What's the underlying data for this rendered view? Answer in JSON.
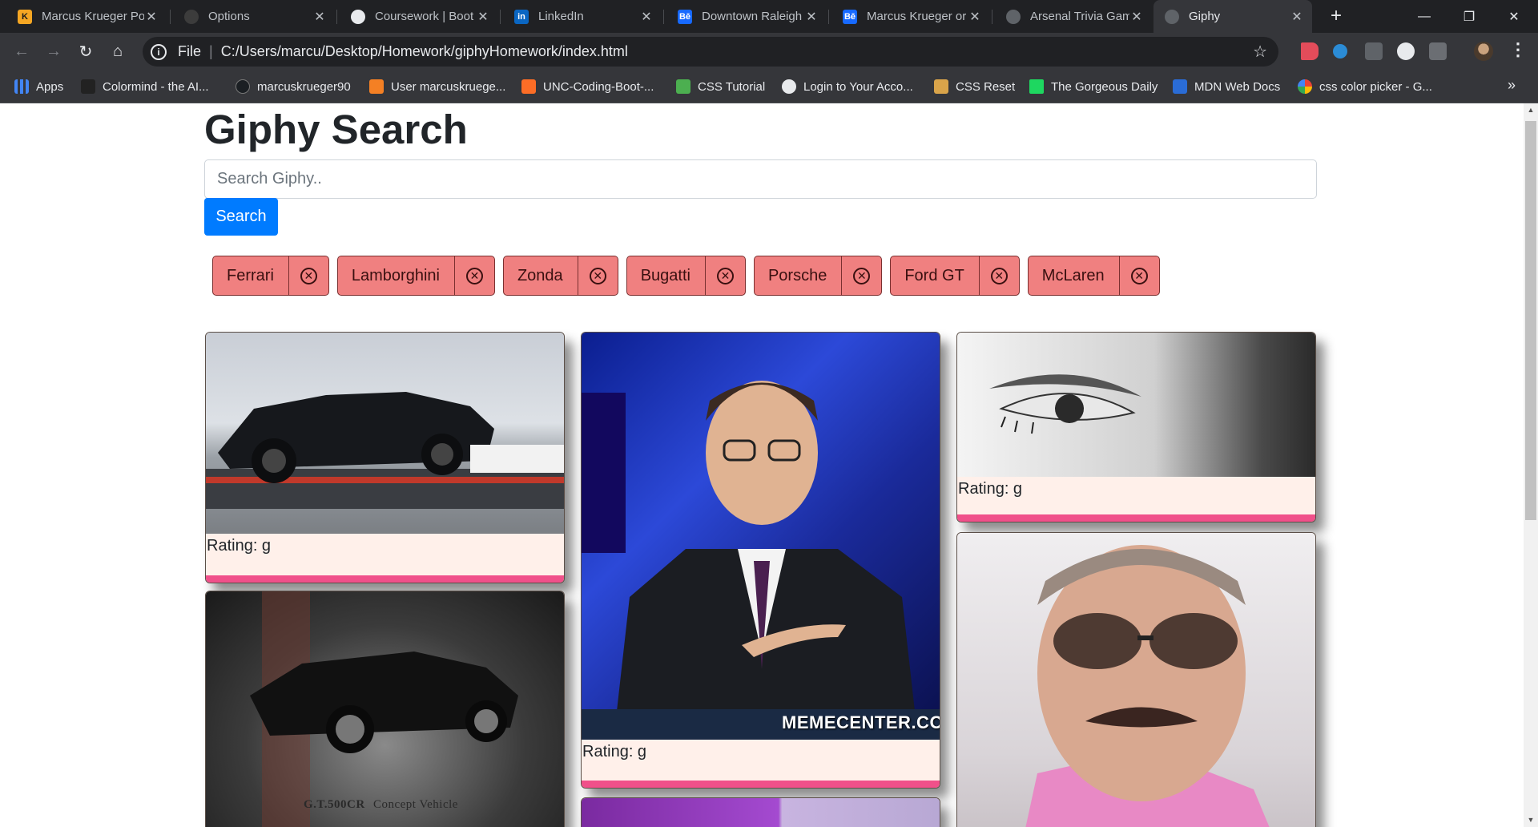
{
  "browser": {
    "tabs": [
      {
        "title": "Marcus Krueger Po",
        "favicon": "K",
        "favicon_color": "#f5a623"
      },
      {
        "title": "Options",
        "favicon": "",
        "favicon_color": "#3c3c3c"
      },
      {
        "title": "Coursework | Boot",
        "favicon": "",
        "favicon_color": "#5f6368"
      },
      {
        "title": "LinkedIn",
        "favicon": "in",
        "favicon_color": "#0a66c2"
      },
      {
        "title": "Downtown Raleigh",
        "favicon": "Bē",
        "favicon_color": "#1769ff"
      },
      {
        "title": "Marcus Krueger or",
        "favicon": "Bē",
        "favicon_color": "#1769ff"
      },
      {
        "title": "Arsenal Trivia Gam",
        "favicon": "",
        "favicon_color": "#5f6368"
      },
      {
        "title": "Giphy",
        "favicon": "",
        "favicon_color": "#5f6368"
      }
    ],
    "close_glyph": "✕",
    "new_tab_glyph": "+",
    "window_controls": {
      "minimize": "—",
      "restore": "❐",
      "close": "✕"
    },
    "nav": {
      "back": "←",
      "forward": "→",
      "reload": "↻",
      "home": "⌂"
    },
    "address": {
      "scheme_label": "File",
      "separator": "|",
      "url": "C:/Users/marcu/Desktop/Homework/giphyHomework/index.html",
      "info_glyph": "i",
      "star_glyph": "☆"
    },
    "menu_glyph": "⋮",
    "bookmarks": [
      {
        "label": "Apps",
        "icon": "apps-grid-icon",
        "color": "#4285f4"
      },
      {
        "label": "Colormind - the AI...",
        "icon": "colormind-icon",
        "color": "#222222"
      },
      {
        "label": "marcuskrueger90",
        "icon": "github-icon",
        "color": "#1b1f23"
      },
      {
        "label": "User marcuskruege...",
        "icon": "stackoverflow-icon",
        "color": "#f48024"
      },
      {
        "label": "UNC-Coding-Boot-...",
        "icon": "gitlab-icon",
        "color": "#fc6d26"
      },
      {
        "label": "CSS Tutorial",
        "icon": "w3schools-icon",
        "color": "#4caf50"
      },
      {
        "label": "Login to Your Acco...",
        "icon": "globe-icon",
        "color": "#5f6368"
      },
      {
        "label": "CSS Reset",
        "icon": "reset-icon",
        "color": "#d9a44a"
      },
      {
        "label": "The Gorgeous Daily",
        "icon": "gorgeous-icon",
        "color": "#1ed760"
      },
      {
        "label": "MDN Web Docs",
        "icon": "mdn-icon",
        "color": "#2a6cd6"
      },
      {
        "label": "css color picker - G...",
        "icon": "google-icon",
        "color": "#ea4335"
      }
    ],
    "bookmarks_more": "»"
  },
  "page": {
    "title": "Giphy Search",
    "search": {
      "placeholder": "Search Giphy..",
      "value": ""
    },
    "search_button": "Search",
    "topics": [
      "Ferrari",
      "Lamborghini",
      "Zonda",
      "Bugatti",
      "Porsche",
      "Ford GT",
      "McLaren"
    ],
    "topic_delete_glyph": "✕",
    "gifs": [
      {
        "rating": "Rating: g",
        "subject": "black mustang on trailer"
      },
      {
        "rating": "Rating: g",
        "subject": "colbert shrug",
        "watermark": "MEMECENTER.COM"
      },
      {
        "rating": "Rating: g",
        "subject": "eye closeup"
      },
      {
        "rating": "",
        "subject": "GT500CR concept car",
        "caption_left": "G.T.500CR",
        "caption_right": "Concept Vehicle"
      },
      {
        "rating": "",
        "subject": "man with sunglasses and mustache"
      },
      {
        "rating": "",
        "subject": "purple partial gif"
      }
    ]
  },
  "colors": {
    "chip_bg": "#f08080",
    "card_bg": "#fff0ea",
    "card_stripe": "#f0508a",
    "button_primary": "#007bff"
  }
}
